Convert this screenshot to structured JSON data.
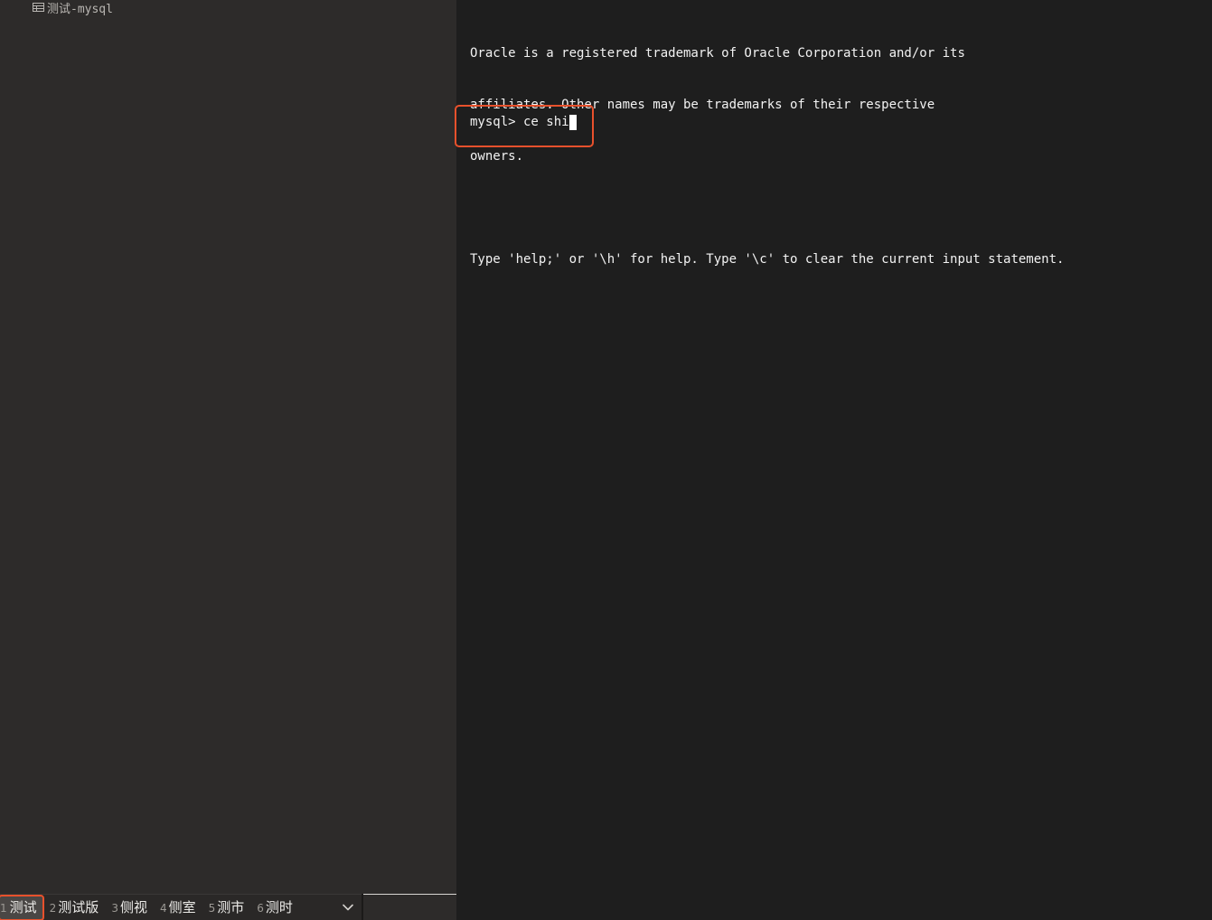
{
  "sidebar": {
    "tree": {
      "item_label": "测试-mysql",
      "item_icon": "database-table-icon"
    }
  },
  "ime": {
    "candidates": [
      {
        "num": "1",
        "word": "测试",
        "selected": true
      },
      {
        "num": "2",
        "word": "测试版",
        "selected": false
      },
      {
        "num": "3",
        "word": "侧视",
        "selected": false
      },
      {
        "num": "4",
        "word": "侧室",
        "selected": false
      },
      {
        "num": "5",
        "word": "测市",
        "selected": false
      },
      {
        "num": "6",
        "word": "测时",
        "selected": false
      }
    ],
    "expand_icon": "chevron-down-icon"
  },
  "terminal": {
    "lines": [
      "Oracle is a registered trademark of Oracle Corporation and/or its",
      "affiliates. Other names may be trademarks of their respective",
      "owners.",
      "",
      "Type 'help;' or '\\h' for help. Type '\\c' to clear the current input statement."
    ],
    "prompt": "mysql>",
    "input": " ce shi"
  },
  "colors": {
    "highlight": "#e8512c",
    "sidebar_bg": "#2d2b2a",
    "terminal_bg": "#1e1e1e"
  }
}
